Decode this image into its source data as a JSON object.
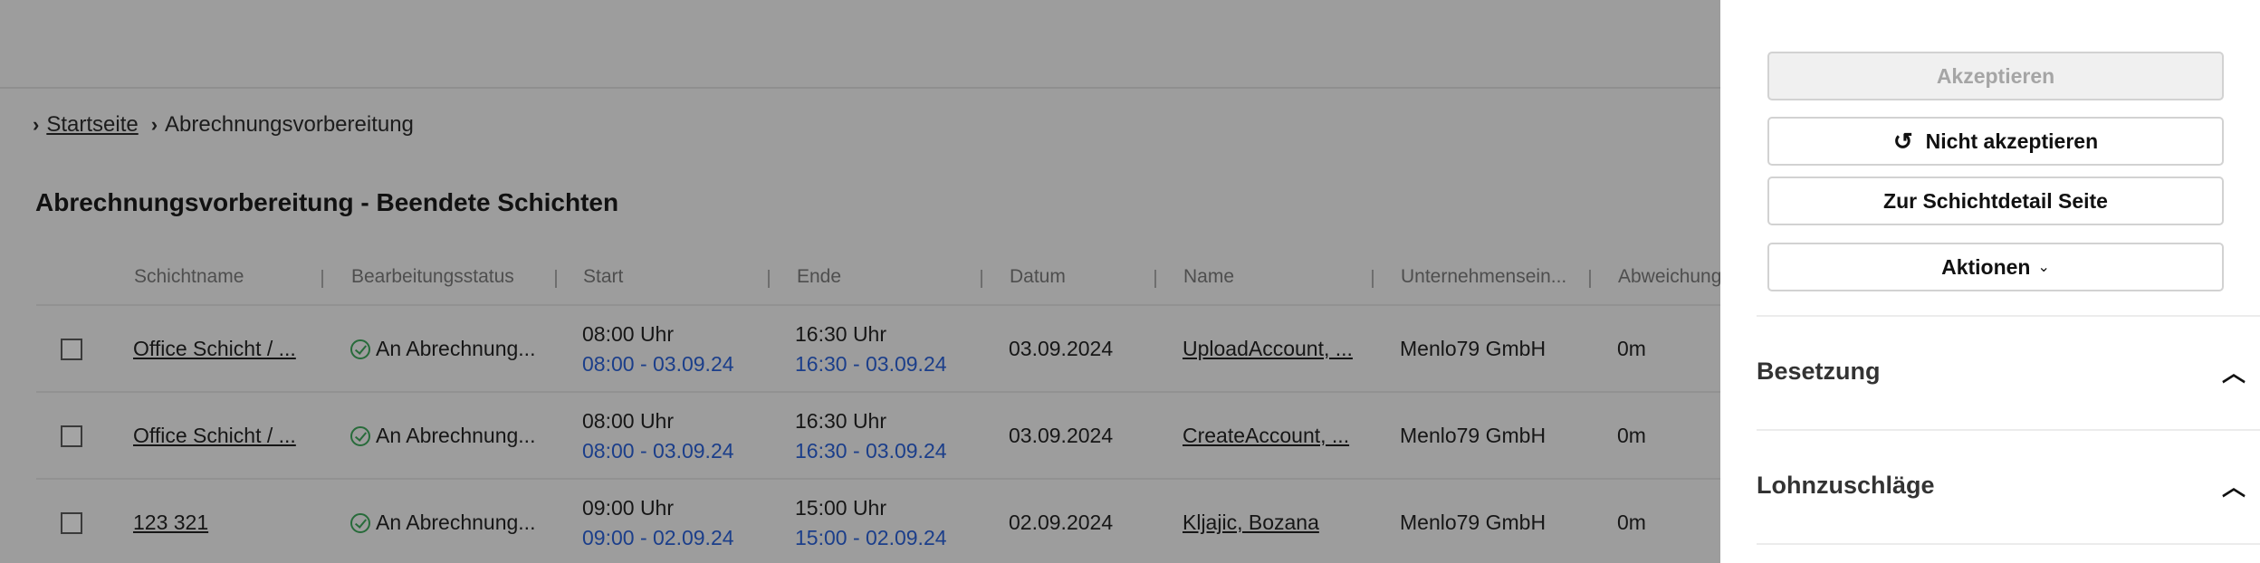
{
  "breadcrumb": {
    "home": "Startseite",
    "current": "Abrechnungsvorbereitung"
  },
  "page_title": "Abrechnungsvorbereitung - Beendete Schichten",
  "table": {
    "columns": [
      "Schichtname",
      "Bearbeitungsstatus",
      "Start",
      "Ende",
      "Datum",
      "Name",
      "Unternehmensein...",
      "Abweichung"
    ],
    "rows": [
      {
        "shift": "Office Schicht / ...",
        "status": "An Abrechnung...",
        "start_time": "08:00 Uhr",
        "start_detail": "08:00 - 03.09.24",
        "end_time": "16:30 Uhr",
        "end_detail": "16:30 - 03.09.24",
        "date": "03.09.2024",
        "name": "UploadAccount, ...",
        "company": "Menlo79 GmbH",
        "deviation": "0m"
      },
      {
        "shift": "Office Schicht / ...",
        "status": "An Abrechnung...",
        "start_time": "08:00 Uhr",
        "start_detail": "08:00 - 03.09.24",
        "end_time": "16:30 Uhr",
        "end_detail": "16:30 - 03.09.24",
        "date": "03.09.2024",
        "name": "CreateAccount, ...",
        "company": "Menlo79 GmbH",
        "deviation": "0m"
      },
      {
        "shift": "123 321",
        "status": "An Abrechnung...",
        "start_time": "09:00 Uhr",
        "start_detail": "09:00 - 02.09.24",
        "end_time": "15:00 Uhr",
        "end_detail": "15:00 - 02.09.24",
        "date": "02.09.2024",
        "name": "Kljajic, Bozana",
        "company": "Menlo79 GmbH",
        "deviation": "0m"
      }
    ]
  },
  "panel": {
    "accept": "Akzeptieren",
    "reject": "Nicht akzeptieren",
    "detail": "Zur Schichtdetail Seite",
    "actions": "Aktionen",
    "sections": [
      "Besetzung",
      "Lohnzuschläge"
    ]
  },
  "icons": {
    "reject": "undo-icon",
    "actions": "chevron-down-icon",
    "sections": "chevron-up-icon",
    "status": "check-circle-icon"
  },
  "colors": {
    "link_blue": "#1b3e8a",
    "status_green": "#276b3a"
  }
}
